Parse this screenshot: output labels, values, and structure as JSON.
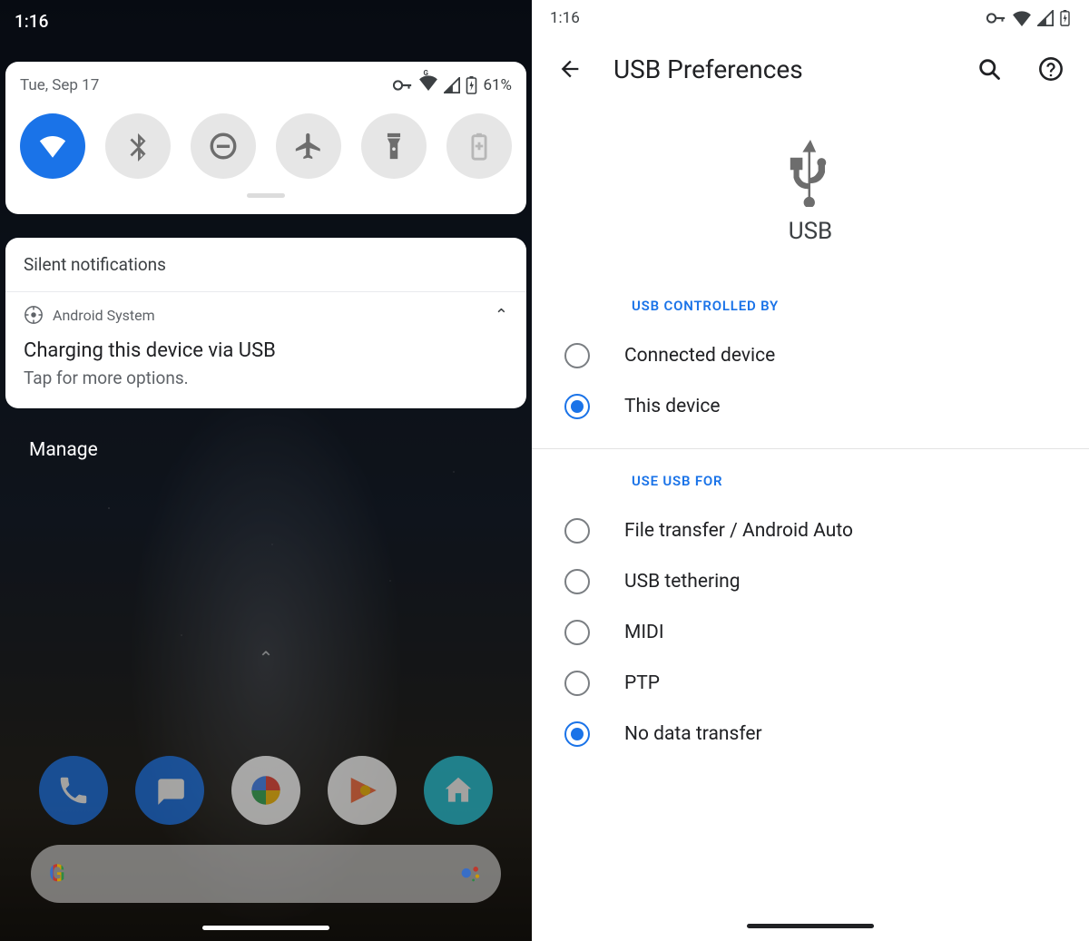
{
  "left": {
    "status_time": "1:16",
    "shade": {
      "date": "Tue, Sep 17",
      "battery_text": "61%",
      "qs": [
        {
          "name": "wifi",
          "on": true
        },
        {
          "name": "bluetooth",
          "on": false
        },
        {
          "name": "dnd",
          "on": false
        },
        {
          "name": "airplane",
          "on": false
        },
        {
          "name": "flashlight",
          "on": false
        },
        {
          "name": "battery-saver",
          "on": false
        }
      ]
    },
    "silent_header": "Silent notifications",
    "notification": {
      "app": "Android System",
      "title": "Charging this device via USB",
      "subtitle": "Tap for more options."
    },
    "manage": "Manage",
    "dock": [
      "Phone",
      "Messages",
      "Photos",
      "Play Music",
      "Home"
    ]
  },
  "right": {
    "status_time": "1:16",
    "title": "USB Preferences",
    "hero_label": "USB",
    "section1_title": "USB CONTROLLED BY",
    "control_options": [
      {
        "label": "Connected device",
        "checked": false
      },
      {
        "label": "This device",
        "checked": true
      }
    ],
    "section2_title": "USE USB FOR",
    "use_options": [
      {
        "label": "File transfer / Android Auto",
        "checked": false
      },
      {
        "label": "USB tethering",
        "checked": false
      },
      {
        "label": "MIDI",
        "checked": false
      },
      {
        "label": "PTP",
        "checked": false
      },
      {
        "label": "No data transfer",
        "checked": true
      }
    ]
  }
}
